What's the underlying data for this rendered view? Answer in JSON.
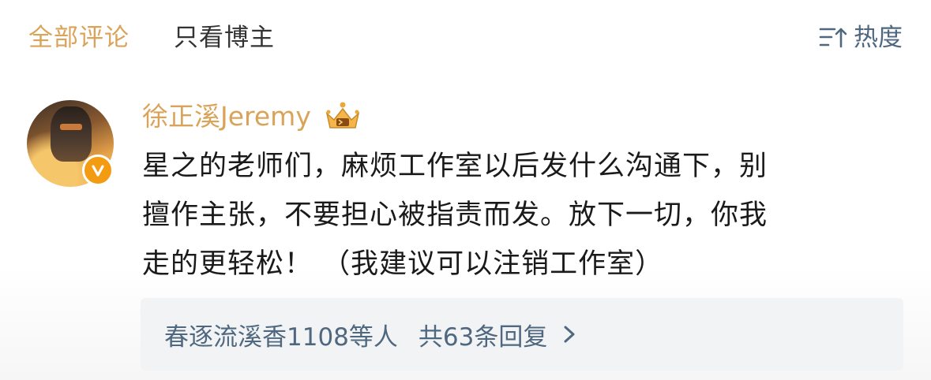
{
  "tabs": {
    "all_comments": "全部评论",
    "author_only": "只看博主"
  },
  "sort": {
    "label": "热度",
    "icon": "sort-icon"
  },
  "comment": {
    "username": "徐正溪Jeremy",
    "verified_color": "#f39c12",
    "text_lines": [
      "星之的老师们，麻烦工作室以后发什么沟通下，别",
      "擅作主张，不要担心被指责而发。放下一切，你我",
      "走的更轻松！ （我建议可以注销工作室）"
    ]
  },
  "replies": {
    "likers": "春逐流溪香1108等人",
    "count_label": "共63条回复"
  },
  "colors": {
    "accent": "#d9a45a",
    "link": "#4f6880",
    "text": "#1a1a1a"
  }
}
